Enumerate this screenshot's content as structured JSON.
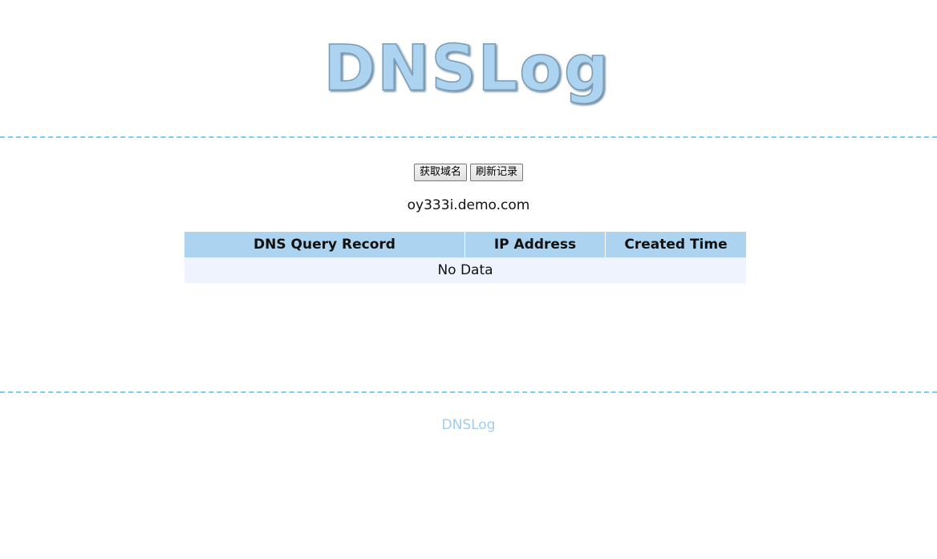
{
  "logo": {
    "text": "DNSLog",
    "color": "#acd4f0"
  },
  "actions": {
    "get_domain_label": "获取域名",
    "refresh_label": "刷新记录"
  },
  "domain": "oy333i.demo.com",
  "table": {
    "headers": [
      "DNS Query Record",
      "IP Address",
      "Created Time"
    ],
    "empty_text": "No Data"
  },
  "footer": {
    "text": "DNSLog"
  },
  "colors": {
    "accent": "#7ccdee",
    "header_bg": "#acd4f0",
    "row_bg": "#eef3fe",
    "footer_text": "#9fcdee"
  }
}
